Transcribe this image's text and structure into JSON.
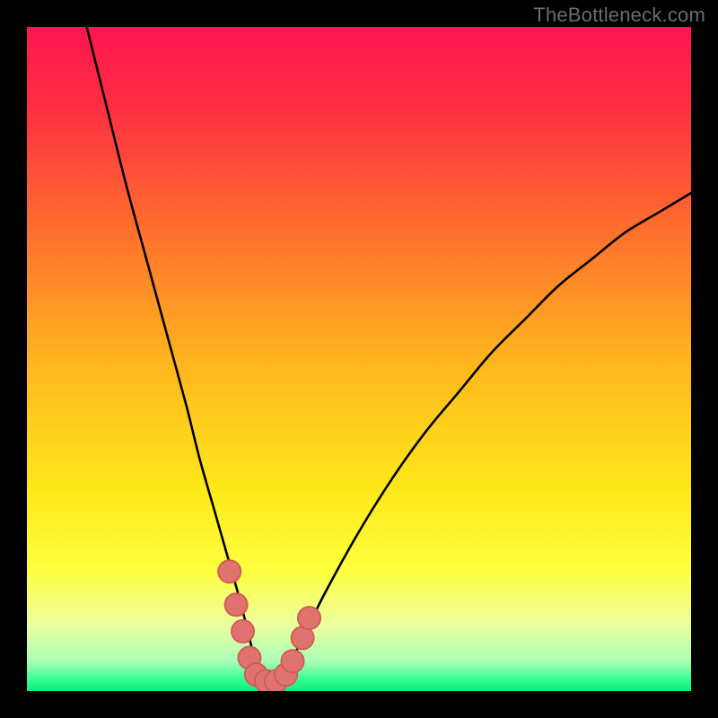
{
  "watermark": {
    "text": "TheBottleneck.com"
  },
  "colors": {
    "frame": "#000000",
    "gradient_stops": [
      {
        "offset": 0.0,
        "color": "#ff1650"
      },
      {
        "offset": 0.12,
        "color": "#ff2e43"
      },
      {
        "offset": 0.3,
        "color": "#ff6d2e"
      },
      {
        "offset": 0.5,
        "color": "#ffb41e"
      },
      {
        "offset": 0.7,
        "color": "#ffe91a"
      },
      {
        "offset": 0.82,
        "color": "#fdff3f"
      },
      {
        "offset": 0.9,
        "color": "#edffa0"
      },
      {
        "offset": 0.955,
        "color": "#a9ffb4"
      },
      {
        "offset": 0.985,
        "color": "#2dfd8f"
      },
      {
        "offset": 1.0,
        "color": "#14e97e"
      }
    ],
    "curve_stroke": "#000000",
    "marker_fill": "#e0736f",
    "marker_stroke": "#cf5b57"
  },
  "chart_data": {
    "type": "line",
    "title": "",
    "xlabel": "",
    "ylabel": "",
    "xlim": [
      0,
      100
    ],
    "ylim": [
      0,
      100
    ],
    "series": [
      {
        "name": "bottleneck-curve",
        "x": [
          9,
          12,
          15,
          18,
          21,
          24,
          26,
          28,
          30,
          32,
          33,
          34,
          35,
          36,
          37,
          38,
          40,
          42,
          45,
          50,
          55,
          60,
          65,
          70,
          75,
          80,
          85,
          90,
          95,
          100
        ],
        "y": [
          100,
          88,
          76,
          65,
          54,
          43,
          35,
          28,
          21,
          14,
          10,
          6,
          3,
          1,
          1,
          2,
          5,
          9,
          15,
          24,
          32,
          39,
          45,
          51,
          56,
          61,
          65,
          69,
          72,
          75
        ]
      }
    ],
    "markers": [
      {
        "x": 30.5,
        "y": 18
      },
      {
        "x": 31.5,
        "y": 13
      },
      {
        "x": 32.5,
        "y": 9
      },
      {
        "x": 33.5,
        "y": 5
      },
      {
        "x": 34.5,
        "y": 2.5
      },
      {
        "x": 36.0,
        "y": 1.5
      },
      {
        "x": 37.5,
        "y": 1.5
      },
      {
        "x": 39.0,
        "y": 2.5
      },
      {
        "x": 40.0,
        "y": 4.5
      },
      {
        "x": 41.5,
        "y": 8
      },
      {
        "x": 42.5,
        "y": 11
      }
    ]
  }
}
